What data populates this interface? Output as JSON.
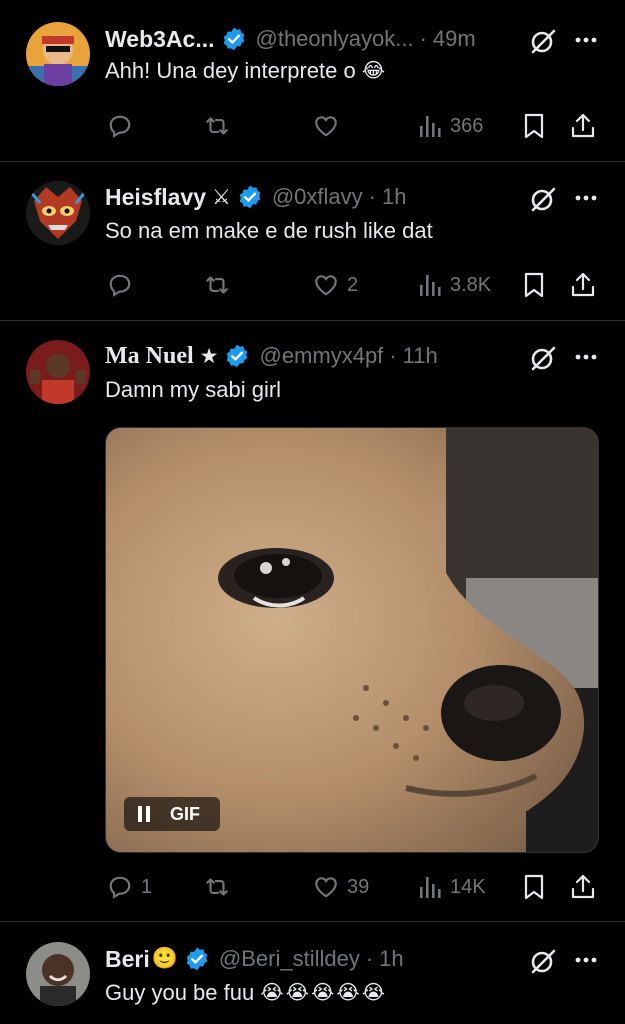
{
  "tweets": [
    {
      "name": "Web3Ac...",
      "handle": "@theonlyayok...",
      "time": "49m",
      "text": "Ahh! Una dey interprete o",
      "emojis": [
        "😂"
      ],
      "replies": "",
      "retweets": "",
      "likes": "",
      "views": "366"
    },
    {
      "name": "Heisflavy",
      "name_glyph": "⚔",
      "handle": "@0xflavy",
      "time": "1h",
      "text": "So na em make e de rush like dat",
      "replies": "",
      "retweets": "",
      "likes": "2",
      "views": "3.8K"
    },
    {
      "name": "Ma Nuel",
      "name_glyph": "★",
      "handle": "@emmyx4pf",
      "time": "11h",
      "text": "Damn my sabi girl",
      "media": {
        "badge": "GIF",
        "description": "crying chihuahua gif"
      },
      "replies": "1",
      "retweets": "",
      "likes": "39",
      "views": "14K"
    },
    {
      "name": "Beri",
      "name_glyph": "🙂",
      "handle": "@Beri_stilldey",
      "time": "1h",
      "text": "Guy you be fuu",
      "emojis": [
        "😭",
        "😭",
        "😭",
        "😭",
        "😭"
      ]
    }
  ],
  "colors": {
    "background": "#000000",
    "text": "#e7e9ea",
    "muted": "#71767b",
    "verified": "#1d9bf0",
    "divider": "#2f3336"
  },
  "icons": [
    "verified-badge-icon",
    "grok-icon",
    "more-icon",
    "reply-icon",
    "retweet-icon",
    "like-icon",
    "views-icon",
    "bookmark-icon",
    "share-icon"
  ]
}
